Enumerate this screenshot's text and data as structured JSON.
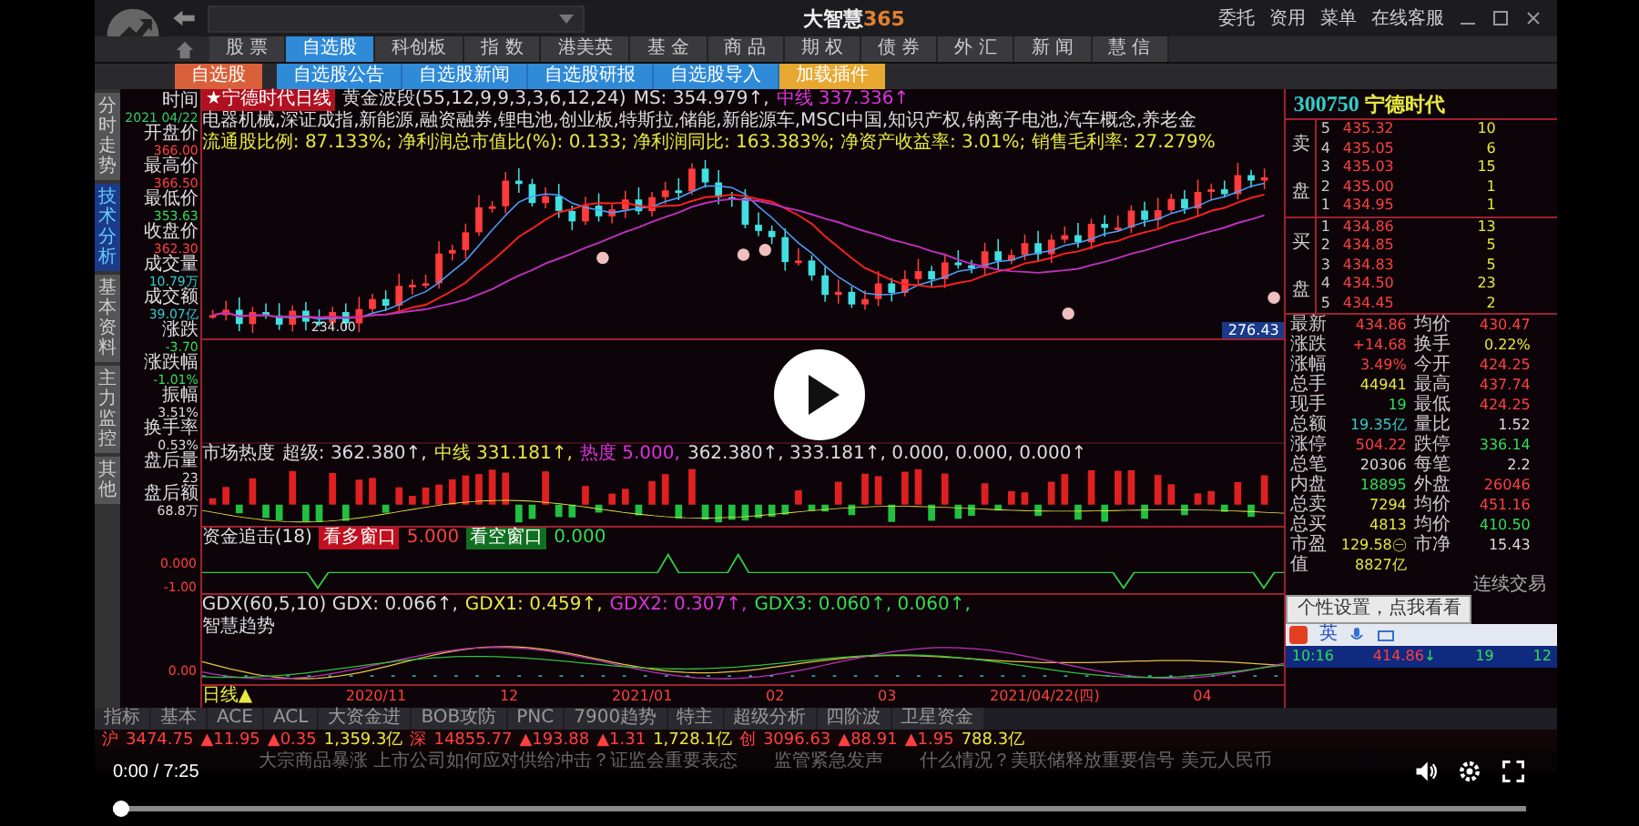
{
  "app": {
    "brand": "大智慧",
    "brand_suffix": "365",
    "top_links": [
      "委托",
      "资用",
      "菜单",
      "在线客服"
    ],
    "nav_tabs": [
      {
        "label": "股 票",
        "selected": false
      },
      {
        "label": "自选股",
        "selected": true
      },
      {
        "label": "科创板",
        "selected": false
      },
      {
        "label": "指 数",
        "selected": false
      },
      {
        "label": "港美英",
        "selected": false
      },
      {
        "label": "基 金",
        "selected": false
      },
      {
        "label": "商 品",
        "selected": false
      },
      {
        "label": "期 权",
        "selected": false
      },
      {
        "label": "债 券",
        "selected": false
      },
      {
        "label": "外 汇",
        "selected": false
      },
      {
        "label": "新 闻",
        "selected": false
      },
      {
        "label": "慧 信",
        "selected": false
      }
    ],
    "sub_tabs": [
      {
        "label": "自选股",
        "kind": "home"
      },
      {
        "label": "自选股公告",
        "kind": "link"
      },
      {
        "label": "自选股新闻",
        "kind": "link"
      },
      {
        "label": "自选股研报",
        "kind": "link"
      },
      {
        "label": "自选股导入",
        "kind": "link"
      },
      {
        "label": "加载插件",
        "kind": "promo"
      }
    ],
    "side_tabs": [
      {
        "label": "分时走势",
        "selected": false
      },
      {
        "label": "技术分析",
        "selected": true
      },
      {
        "label": "基本资料",
        "selected": false
      },
      {
        "label": "主力监控",
        "selected": false
      },
      {
        "label": "其他",
        "selected": false
      }
    ],
    "quote_info": [
      {
        "label": "时间",
        "value": "2021 04/22",
        "color": "#33cc66"
      },
      {
        "label": "开盘价",
        "value": "366.00",
        "color": "#ff4040"
      },
      {
        "label": "最高价",
        "value": "366.50",
        "color": "#ff4040"
      },
      {
        "label": "最低价",
        "value": "353.63",
        "color": "#33dd55"
      },
      {
        "label": "收盘价",
        "value": "362.30",
        "color": "#ff4040"
      },
      {
        "label": "成交量",
        "value": "10.79万",
        "color": "#33cccc"
      },
      {
        "label": "成交额",
        "value": "39.07亿",
        "color": "#33cccc"
      },
      {
        "label": "涨跌",
        "value": "-3.70",
        "color": "#33dd55"
      },
      {
        "label": "涨跌幅",
        "value": "-1.01%",
        "color": "#33dd55"
      },
      {
        "label": "振幅",
        "value": "3.51%",
        "color": "#dddddd"
      },
      {
        "label": "换手率",
        "value": "0.53%",
        "color": "#dddddd"
      },
      {
        "label": "盘后量",
        "value": "23",
        "color": "#dddddd"
      },
      {
        "label": "盘后额",
        "value": "68.8万",
        "color": "#dddddd"
      }
    ],
    "chart_header": [
      {
        "text": "★宁德时代日线",
        "color": "#b01020",
        "kind": "box"
      },
      {
        "text": "黄金波段(55,12,9,9,3,3,6,12,24)",
        "color": "#dddddd"
      },
      {
        "text": "MS: 354.979↑,",
        "color": "#dddddd"
      },
      {
        "text": "中线 337.336↑",
        "color": "#dd33dd"
      }
    ],
    "concepts": "电器机械,深证成指,新能源,融资融券,锂电池,创业板,特斯拉,储能,新能源车,MSCI中国,知识产权,钠离子电池,汽车概念,养老金",
    "fundamentals": "流通股比例: 87.133%; 净利润总市值比(%): 0.133; 净利润同比: 163.383%; 净资产收益率: 3.01%; 销售毛利率: 27.279%",
    "price_tag": "276.43",
    "low_tag": "234.00",
    "heat_header": [
      {
        "text": "市场热度",
        "color": "#dddddd"
      },
      {
        "text": "超级: 362.380↑,",
        "color": "#dddddd"
      },
      {
        "text": "中线 331.181↑,",
        "color": "#e8e840"
      },
      {
        "text": "热度 5.000,",
        "color": "#dd33dd"
      },
      {
        "text": "362.380↑, 333.181↑, 0.000, 0.000, 0.000↑",
        "color": "#dddddd"
      }
    ],
    "chase_header": [
      {
        "text": "资金追击(18)",
        "color": "#dddddd"
      },
      {
        "text": "看多窗口",
        "color": "#c01020",
        "kind": "box"
      },
      {
        "text": "5.000",
        "color": "#ff4040"
      },
      {
        "text": "看空窗口",
        "color": "#107020",
        "kind": "box"
      },
      {
        "text": "0.000",
        "color": "#33dd55"
      }
    ],
    "chase_axis": [
      "0.000",
      "-1.00"
    ],
    "trend_header": [
      {
        "text": "GDX(60,5,10) GDX: 0.066↑,",
        "color": "#dddddd"
      },
      {
        "text": "GDX1: 0.459↑,",
        "color": "#e8e840"
      },
      {
        "text": "GDX2: 0.307↑,",
        "color": "#dd33dd"
      },
      {
        "text": "GDX3: 0.060↑, 0.060↑,",
        "color": "#33dd55"
      }
    ],
    "trend_title": "智慧趋势",
    "trend_axis": "0.00",
    "period": "日线▲",
    "dates": [
      "2020/11",
      "12",
      "2021/01",
      "02",
      "03",
      "2021/04/22(四)",
      "04"
    ],
    "stock": {
      "code": "300750",
      "name": "宁德时代"
    },
    "sell_label": [
      "卖",
      "盘"
    ],
    "buy_label": [
      "买",
      "盘"
    ],
    "asks": [
      {
        "rank": "5",
        "price": "435.32",
        "volume": "10"
      },
      {
        "rank": "4",
        "price": "435.05",
        "volume": "6"
      },
      {
        "rank": "3",
        "price": "435.03",
        "volume": "15"
      },
      {
        "rank": "2",
        "price": "435.00",
        "volume": "1"
      },
      {
        "rank": "1",
        "price": "434.95",
        "volume": "1"
      }
    ],
    "bids": [
      {
        "rank": "1",
        "price": "434.86",
        "volume": "13"
      },
      {
        "rank": "2",
        "price": "434.85",
        "volume": "5"
      },
      {
        "rank": "3",
        "price": "434.83",
        "volume": "5"
      },
      {
        "rank": "4",
        "price": "434.50",
        "volume": "23"
      },
      {
        "rank": "5",
        "price": "434.45",
        "volume": "2"
      }
    ],
    "stats": [
      {
        "label": "最新",
        "value": "434.86",
        "color": "#ff4040"
      },
      {
        "label": "均价",
        "value": "430.47",
        "color": "#ff4040"
      },
      {
        "label": "涨跌",
        "value": "+14.68",
        "color": "#ff4040"
      },
      {
        "label": "换手",
        "value": "0.22%",
        "color": "#e8e840"
      },
      {
        "label": "涨幅",
        "value": "3.49%",
        "color": "#ff4040"
      },
      {
        "label": "今开",
        "value": "424.25",
        "color": "#ff4040"
      },
      {
        "label": "总手",
        "value": "44941",
        "color": "#e8e840"
      },
      {
        "label": "最高",
        "value": "437.74",
        "color": "#ff4040"
      },
      {
        "label": "现手",
        "value": "19",
        "color": "#33dd55"
      },
      {
        "label": "最低",
        "value": "424.25",
        "color": "#ff4040"
      },
      {
        "label": "总额",
        "value": "19.35亿",
        "color": "#33cccc"
      },
      {
        "label": "量比",
        "value": "1.52",
        "color": "#dddddd"
      },
      {
        "label": "涨停",
        "value": "504.22",
        "color": "#ff4040"
      },
      {
        "label": "跌停",
        "value": "336.14",
        "color": "#33dd55"
      },
      {
        "label": "总笔",
        "value": "20306",
        "color": "#dddddd"
      },
      {
        "label": "每笔",
        "value": "2.2",
        "color": "#dddddd"
      },
      {
        "label": "内盘",
        "value": "18895",
        "color": "#33dd55"
      },
      {
        "label": "外盘",
        "value": "26046",
        "color": "#ff4040"
      },
      {
        "label": "总卖",
        "value": "7294",
        "color": "#e8e840"
      },
      {
        "label": "均价",
        "value": "451.16",
        "color": "#ff4040"
      },
      {
        "label": "总买",
        "value": "4813",
        "color": "#e8e840"
      },
      {
        "label": "均价",
        "value": "410.50",
        "color": "#33dd55"
      },
      {
        "label": "市盈",
        "value": "129.58㊀",
        "color": "#e8e840"
      },
      {
        "label": "市净",
        "value": "15.43",
        "color": "#dddddd"
      },
      {
        "label": "值",
        "value": "8827亿",
        "color": "#e8e840"
      }
    ],
    "session": "连续交易",
    "tooltip": "个性设置，点我看看",
    "ime_mode": "英",
    "tick": {
      "time": "10:16",
      "price": "414.86",
      "arrow": "↓",
      "volume": "19",
      "count": "12"
    },
    "indicator_tabs": [
      "指标",
      "基本",
      "ACE",
      "ACL",
      "大资金进",
      "BOB攻防",
      "PNC",
      "7900趋势",
      "特主",
      "超级分析",
      "四阶波",
      "卫星资金"
    ],
    "ticker": [
      {
        "text": "沪",
        "color": "#ff4040"
      },
      {
        "text": "3474.75",
        "color": "#ff4040"
      },
      {
        "text": "▲11.95",
        "color": "#ff4040"
      },
      {
        "text": "▲0.35",
        "color": "#ff4040"
      },
      {
        "text": "1,359.3亿",
        "color": "#e8e840"
      },
      {
        "text": "深",
        "color": "#ff4040"
      },
      {
        "text": "14855.77",
        "color": "#ff4040"
      },
      {
        "text": "▲193.88",
        "color": "#ff4040"
      },
      {
        "text": "▲1.31",
        "color": "#ff4040"
      },
      {
        "text": "1,728.1亿",
        "color": "#e8e840"
      },
      {
        "text": "创",
        "color": "#ff4040"
      },
      {
        "text": "3096.63",
        "color": "#ff4040"
      },
      {
        "text": "▲88.91",
        "color": "#ff4040"
      },
      {
        "text": "▲1.95",
        "color": "#ff4040"
      },
      {
        "text": "788.3亿",
        "color": "#e8e840"
      }
    ],
    "news": [
      "大宗商品暴涨 上市公司如何应对供给冲击？证监会重要表态",
      "监管紧急发声",
      "什么情况？美联储释放重要信号 美元人民币"
    ]
  },
  "player": {
    "time": "0:00 / 7:25",
    "level": 0.005
  }
}
